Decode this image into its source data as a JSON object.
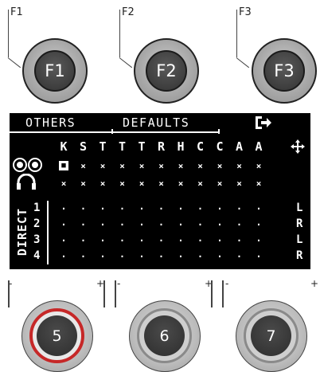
{
  "fkeys": [
    {
      "label": "F1",
      "cap": "F1"
    },
    {
      "label": "F2",
      "cap": "F2"
    },
    {
      "label": "F3",
      "cap": "F3"
    }
  ],
  "menu": {
    "items": [
      "OTHERS",
      "DEFAULTS"
    ],
    "exit_icon": "exit-arrow-icon"
  },
  "matrix": {
    "columns": [
      "K",
      "S",
      "T",
      "T",
      "T",
      "R",
      "H",
      "C",
      "C",
      "A",
      "A"
    ],
    "move_icon": "four-way-arrow-icon",
    "rows": [
      {
        "name": "speakers",
        "icon": "speakers-icon",
        "cells": [
          "■",
          "×",
          "×",
          "×",
          "×",
          "×",
          "×",
          "×",
          "×",
          "×",
          "×"
        ],
        "selected_index": 0,
        "pan": ""
      },
      {
        "name": "headphones",
        "icon": "headphones-icon",
        "cells": [
          "×",
          "×",
          "×",
          "×",
          "×",
          "×",
          "×",
          "×",
          "×",
          "×",
          "×"
        ],
        "pan": ""
      },
      {
        "name": "direct-1",
        "label": "1",
        "cells": [
          "·",
          "·",
          "·",
          "·",
          "·",
          "·",
          "·",
          "·",
          "·",
          "·",
          "·"
        ],
        "pan": "L"
      },
      {
        "name": "direct-2",
        "label": "2",
        "cells": [
          "·",
          "·",
          "·",
          "·",
          "·",
          "·",
          "·",
          "·",
          "·",
          "·",
          "·"
        ],
        "pan": "R"
      },
      {
        "name": "direct-3",
        "label": "3",
        "cells": [
          "·",
          "·",
          "·",
          "·",
          "·",
          "·",
          "·",
          "·",
          "·",
          "·",
          "·"
        ],
        "pan": "L"
      },
      {
        "name": "direct-4",
        "label": "4",
        "cells": [
          "·",
          "·",
          "·",
          "·",
          "·",
          "·",
          "·",
          "·",
          "·",
          "·",
          "·"
        ],
        "pan": "R"
      }
    ],
    "direct_label": "DIRECT"
  },
  "knobs": [
    {
      "value": "5",
      "minus": "-",
      "plus": "+",
      "active": true
    },
    {
      "value": "6",
      "minus": "-",
      "plus": "+",
      "active": false
    },
    {
      "value": "7",
      "minus": "-",
      "plus": "+",
      "active": false
    }
  ],
  "colors": {
    "active_ring": "#c62828",
    "lcd_bg": "#000000",
    "lcd_fg": "#ffffff"
  }
}
